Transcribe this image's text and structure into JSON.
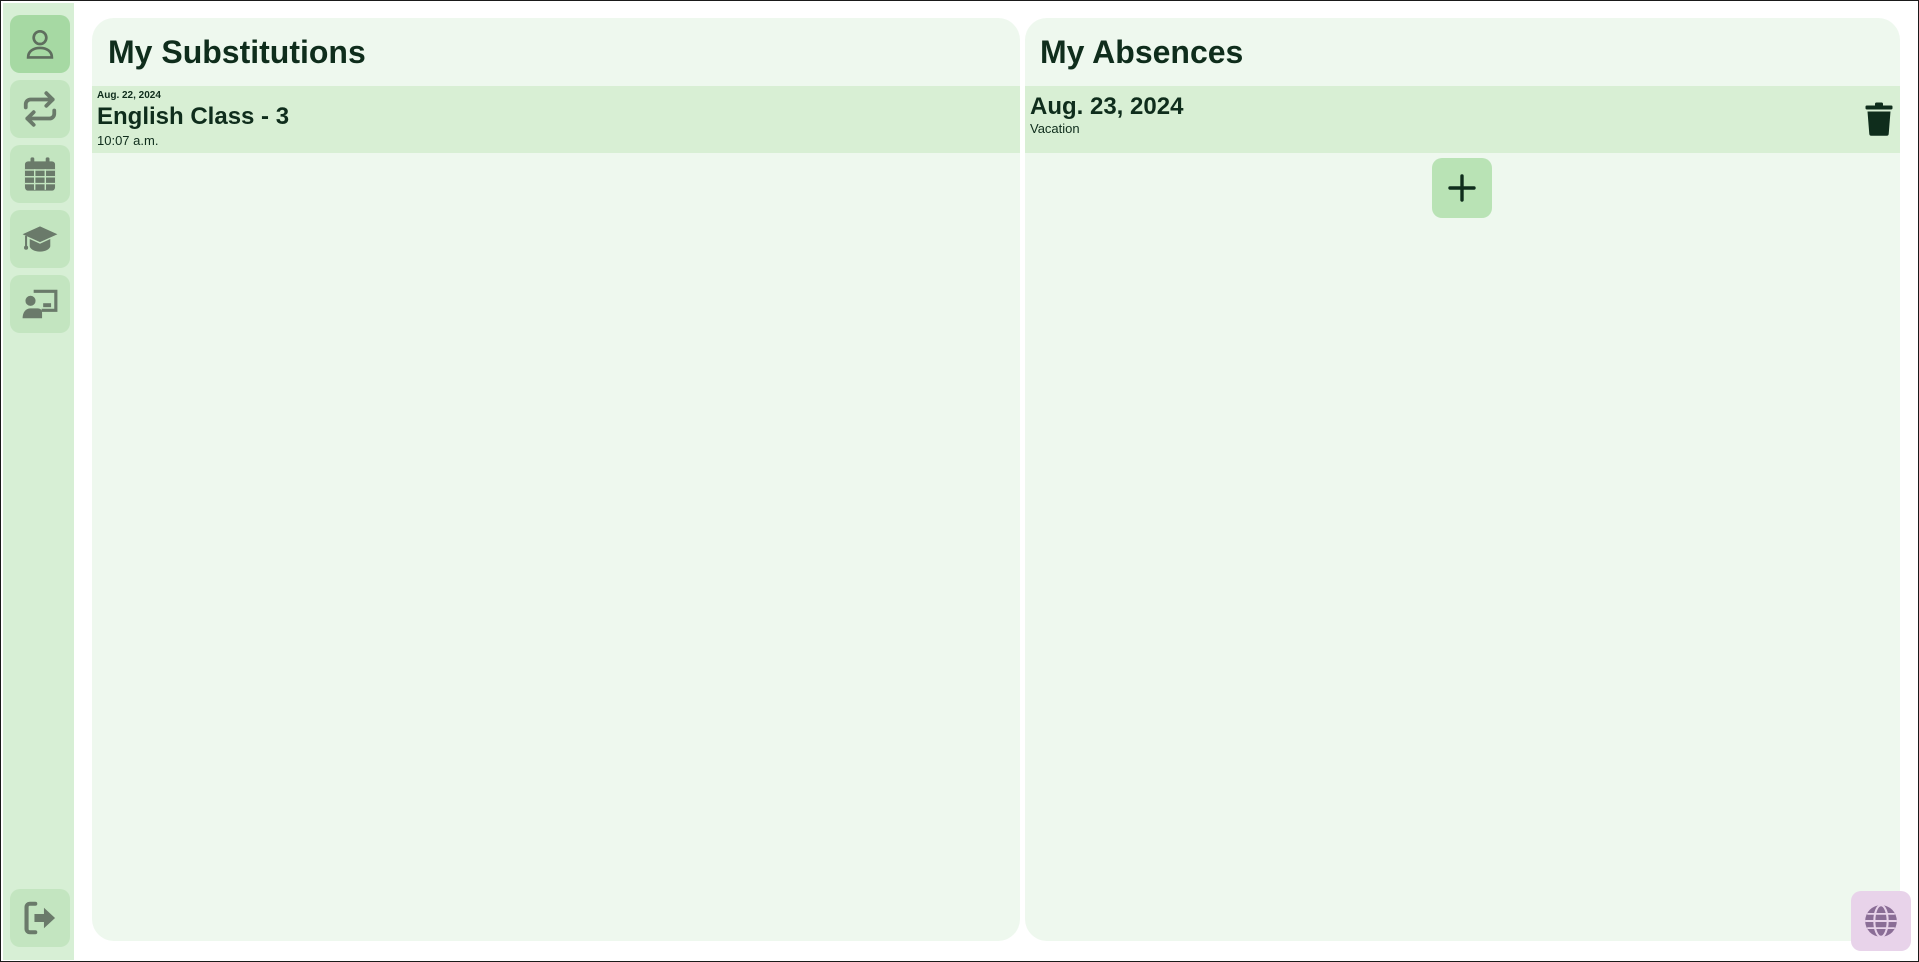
{
  "sidebar": {
    "items": [
      {
        "icon": "user-icon",
        "active": true
      },
      {
        "icon": "repeat-icon",
        "active": false
      },
      {
        "icon": "calendar-icon",
        "active": false
      },
      {
        "icon": "graduation-cap-icon",
        "active": false
      },
      {
        "icon": "teacher-board-icon",
        "active": false
      }
    ],
    "logout_icon": "logout-icon"
  },
  "substitutions": {
    "title": "My Substitutions",
    "items": [
      {
        "date": "Aug. 22, 2024",
        "title": "English Class - 3",
        "time": "10:07 a.m."
      }
    ]
  },
  "absences": {
    "title": "My Absences",
    "items": [
      {
        "date": "Aug. 23, 2024",
        "reason": "Vacation"
      }
    ],
    "add_icon": "plus-icon",
    "delete_icon": "trash-icon"
  },
  "language_icon": "globe-icon",
  "colors": {
    "sidebar_bg": "#d7efd5",
    "panel_bg": "#eef8ee",
    "row_bg": "#d8efd4",
    "button_bg": "#c3e5c0",
    "active_button_bg": "#a6d9a3",
    "icon_color": "#6a7a6a",
    "text_dark": "#0f2d1c",
    "language_button_bg": "#e8d3ea"
  }
}
